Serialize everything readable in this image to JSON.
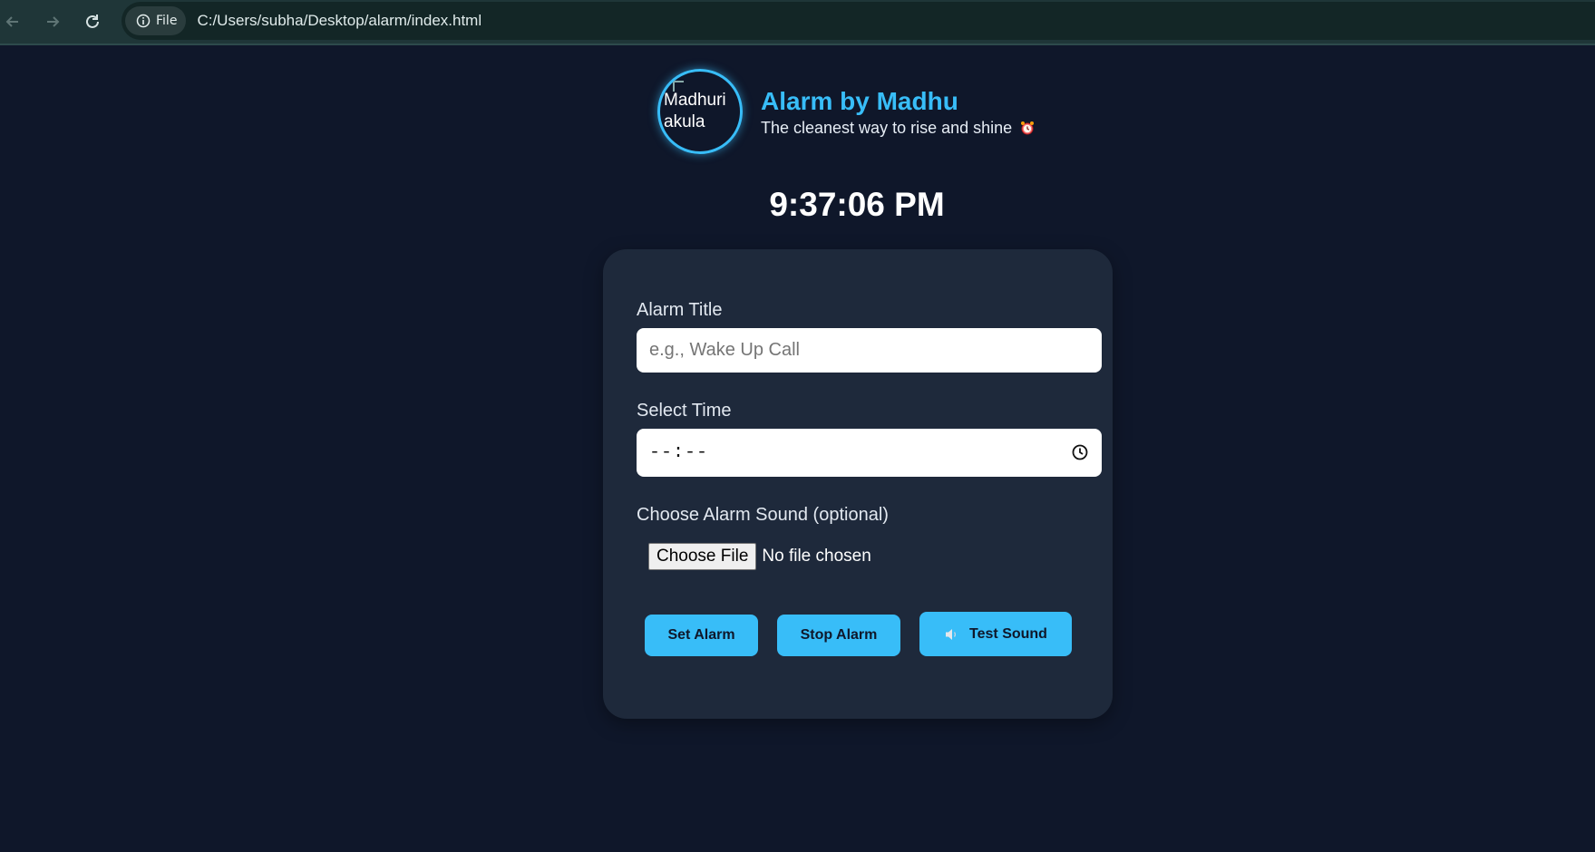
{
  "browser": {
    "back_icon": "arrow-left-icon",
    "forward_icon": "arrow-right-icon",
    "reload_icon": "reload-icon",
    "site_info_label": "File",
    "url": "C:/Users/subha/Desktop/alarm/index.html"
  },
  "header": {
    "avatar_alt": "Madhuri akula",
    "title": "Alarm by Madhu",
    "tagline": "The cleanest way to rise and shine",
    "tagline_icon": "alarm-clock-icon"
  },
  "clock": {
    "time": "9:37:06 PM"
  },
  "form": {
    "title_label": "Alarm Title",
    "title_placeholder": "e.g., Wake Up Call",
    "title_value": "",
    "time_label": "Select Time",
    "time_value": "--:--",
    "sound_label": "Choose Alarm Sound (optional)",
    "file_button": "Choose File",
    "file_status": "No file chosen"
  },
  "buttons": {
    "set_alarm": "Set Alarm",
    "stop_alarm": "Stop Alarm",
    "test_sound": "Test Sound",
    "test_sound_icon": "speaker-icon"
  },
  "colors": {
    "background": "#0f172a",
    "card": "#1e293b",
    "accent": "#38bdf8",
    "browser_bar": "#1f3638"
  }
}
